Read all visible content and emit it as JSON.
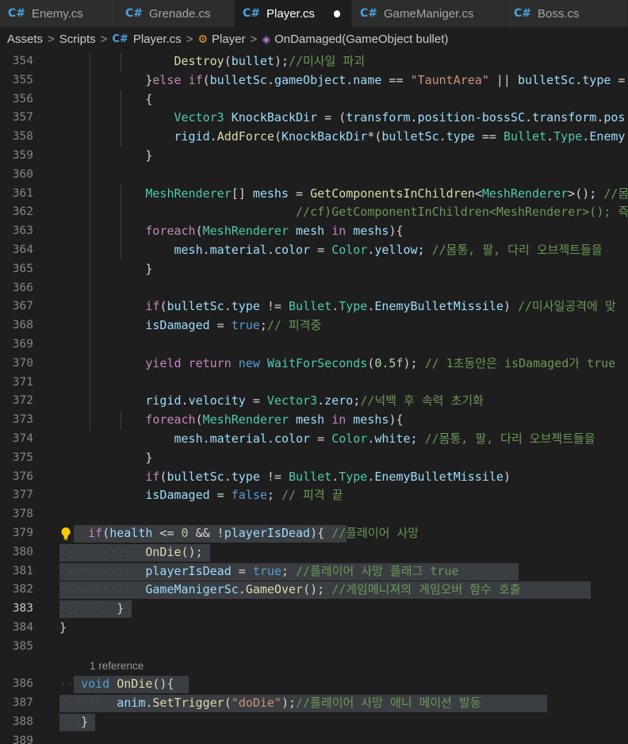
{
  "tabs": [
    {
      "icon": "C#",
      "label": "Enemy.cs",
      "active": false
    },
    {
      "icon": "C#",
      "label": "Grenade.cs",
      "active": false
    },
    {
      "icon": "C#",
      "label": "Player.cs",
      "active": true,
      "modified": true
    },
    {
      "icon": "C#",
      "label": "GameManiger.cs",
      "active": false
    },
    {
      "icon": "C#",
      "label": "Boss.cs",
      "active": false
    }
  ],
  "breadcrumb": {
    "assets": "Assets",
    "scripts": "Scripts",
    "file_icon": "C#",
    "file": "Player.cs",
    "class": "Player",
    "method": "OnDamaged(GameObject bullet)"
  },
  "codelens": "1 reference",
  "current_line": "383",
  "lines": [
    {
      "n": "354",
      "segs": [
        [
          "p",
          "        "
        ],
        [
          "f",
          "Destroy"
        ],
        [
          "p",
          "("
        ],
        [
          "v",
          "bullet"
        ],
        [
          "p",
          ");"
        ],
        [
          "c",
          "//미사일 파괴"
        ]
      ]
    },
    {
      "n": "355",
      "segs": [
        [
          "p",
          "    }"
        ],
        [
          "kc",
          "else"
        ],
        [
          "p",
          " "
        ],
        [
          "kc",
          "if"
        ],
        [
          "p",
          "("
        ],
        [
          "v",
          "bulletSc"
        ],
        [
          "p",
          "."
        ],
        [
          "v",
          "gameObject"
        ],
        [
          "p",
          "."
        ],
        [
          "v",
          "name"
        ],
        [
          "p",
          " == "
        ],
        [
          "s",
          "\"TauntArea\""
        ],
        [
          "p",
          " || "
        ],
        [
          "v",
          "bulletSc"
        ],
        [
          "p",
          "."
        ],
        [
          "v",
          "type"
        ],
        [
          "p",
          " ="
        ]
      ]
    },
    {
      "n": "356",
      "segs": [
        [
          "p",
          "    {"
        ]
      ]
    },
    {
      "n": "357",
      "segs": [
        [
          "p",
          "        "
        ],
        [
          "t",
          "Vector3"
        ],
        [
          "p",
          " "
        ],
        [
          "v",
          "KnockBackDir"
        ],
        [
          "p",
          " = ("
        ],
        [
          "v",
          "transform"
        ],
        [
          "p",
          "."
        ],
        [
          "v",
          "position"
        ],
        [
          "p",
          "-"
        ],
        [
          "v",
          "bossSC"
        ],
        [
          "p",
          "."
        ],
        [
          "v",
          "transform"
        ],
        [
          "p",
          "."
        ],
        [
          "v",
          "pos"
        ]
      ]
    },
    {
      "n": "358",
      "segs": [
        [
          "p",
          "        "
        ],
        [
          "v",
          "rigid"
        ],
        [
          "p",
          "."
        ],
        [
          "f",
          "AddForce"
        ],
        [
          "p",
          "("
        ],
        [
          "v",
          "KnockBackDir"
        ],
        [
          "p",
          "*("
        ],
        [
          "v",
          "bulletSc"
        ],
        [
          "p",
          "."
        ],
        [
          "v",
          "type"
        ],
        [
          "p",
          " == "
        ],
        [
          "t",
          "Bullet"
        ],
        [
          "p",
          "."
        ],
        [
          "t",
          "Type"
        ],
        [
          "p",
          "."
        ],
        [
          "v",
          "Enemy"
        ]
      ]
    },
    {
      "n": "359",
      "segs": [
        [
          "p",
          "    }"
        ]
      ]
    },
    {
      "n": "360",
      "segs": []
    },
    {
      "n": "361",
      "segs": [
        [
          "p",
          "    "
        ],
        [
          "t",
          "MeshRenderer"
        ],
        [
          "p",
          "[] "
        ],
        [
          "v",
          "meshs"
        ],
        [
          "p",
          " = "
        ],
        [
          "f",
          "GetComponentsInChildren"
        ],
        [
          "p",
          "<"
        ],
        [
          "t",
          "MeshRenderer"
        ],
        [
          "p",
          ">(); "
        ],
        [
          "c",
          "//몸"
        ]
      ]
    },
    {
      "n": "362",
      "segs": [
        [
          "p",
          "                         "
        ],
        [
          "c",
          "//cf)GetComponentInChildren<MeshRenderer>(); 즉"
        ]
      ]
    },
    {
      "n": "363",
      "segs": [
        [
          "p",
          "    "
        ],
        [
          "kc",
          "foreach"
        ],
        [
          "p",
          "("
        ],
        [
          "t",
          "MeshRenderer"
        ],
        [
          "p",
          " "
        ],
        [
          "v",
          "mesh"
        ],
        [
          "p",
          " "
        ],
        [
          "kc",
          "in"
        ],
        [
          "p",
          " "
        ],
        [
          "v",
          "meshs"
        ],
        [
          "p",
          "){"
        ]
      ]
    },
    {
      "n": "364",
      "segs": [
        [
          "p",
          "        "
        ],
        [
          "v",
          "mesh"
        ],
        [
          "p",
          "."
        ],
        [
          "v",
          "material"
        ],
        [
          "p",
          "."
        ],
        [
          "v",
          "color"
        ],
        [
          "p",
          " = "
        ],
        [
          "t",
          "Color"
        ],
        [
          "p",
          "."
        ],
        [
          "v",
          "yellow"
        ],
        [
          "p",
          "; "
        ],
        [
          "c",
          "//몸통, 팔, 다리 오브젝트들을"
        ]
      ]
    },
    {
      "n": "365",
      "segs": [
        [
          "p",
          "    }"
        ]
      ]
    },
    {
      "n": "366",
      "segs": []
    },
    {
      "n": "367",
      "segs": [
        [
          "p",
          "    "
        ],
        [
          "kc",
          "if"
        ],
        [
          "p",
          "("
        ],
        [
          "v",
          "bulletSc"
        ],
        [
          "p",
          "."
        ],
        [
          "v",
          "type"
        ],
        [
          "p",
          " != "
        ],
        [
          "t",
          "Bullet"
        ],
        [
          "p",
          "."
        ],
        [
          "t",
          "Type"
        ],
        [
          "p",
          "."
        ],
        [
          "v",
          "EnemyBulletMissile"
        ],
        [
          "p",
          ") "
        ],
        [
          "c",
          "//미사일공격에 맞"
        ]
      ]
    },
    {
      "n": "368",
      "segs": [
        [
          "p",
          "    "
        ],
        [
          "v",
          "isDamaged"
        ],
        [
          "p",
          " = "
        ],
        [
          "k",
          "true"
        ],
        [
          "p",
          ";"
        ],
        [
          "c",
          "// 피격중"
        ]
      ]
    },
    {
      "n": "369",
      "segs": []
    },
    {
      "n": "370",
      "segs": [
        [
          "p",
          "    "
        ],
        [
          "kc",
          "yield"
        ],
        [
          "p",
          " "
        ],
        [
          "kc",
          "return"
        ],
        [
          "p",
          " "
        ],
        [
          "k",
          "new"
        ],
        [
          "p",
          " "
        ],
        [
          "t",
          "WaitForSeconds"
        ],
        [
          "p",
          "("
        ],
        [
          "n",
          "0.5f"
        ],
        [
          "p",
          "); "
        ],
        [
          "c",
          "// 1초동안은 isDamaged가 true"
        ]
      ]
    },
    {
      "n": "371",
      "segs": []
    },
    {
      "n": "372",
      "segs": [
        [
          "p",
          "    "
        ],
        [
          "v",
          "rigid"
        ],
        [
          "p",
          "."
        ],
        [
          "v",
          "velocity"
        ],
        [
          "p",
          " = "
        ],
        [
          "t",
          "Vector3"
        ],
        [
          "p",
          "."
        ],
        [
          "v",
          "zero"
        ],
        [
          "p",
          ";"
        ],
        [
          "c",
          "//넉백 후 속력 초기화"
        ]
      ]
    },
    {
      "n": "373",
      "segs": [
        [
          "p",
          "    "
        ],
        [
          "kc",
          "foreach"
        ],
        [
          "p",
          "("
        ],
        [
          "t",
          "MeshRenderer"
        ],
        [
          "p",
          " "
        ],
        [
          "v",
          "mesh"
        ],
        [
          "p",
          " "
        ],
        [
          "kc",
          "in"
        ],
        [
          "p",
          " "
        ],
        [
          "v",
          "meshs"
        ],
        [
          "p",
          "){"
        ]
      ]
    },
    {
      "n": "374",
      "segs": [
        [
          "p",
          "        "
        ],
        [
          "v",
          "mesh"
        ],
        [
          "p",
          "."
        ],
        [
          "v",
          "material"
        ],
        [
          "p",
          "."
        ],
        [
          "v",
          "color"
        ],
        [
          "p",
          " = "
        ],
        [
          "t",
          "Color"
        ],
        [
          "p",
          "."
        ],
        [
          "v",
          "white"
        ],
        [
          "p",
          "; "
        ],
        [
          "c",
          "//몸통, 팔, 다리 오브젝트들을"
        ]
      ]
    },
    {
      "n": "375",
      "segs": [
        [
          "p",
          "    }"
        ]
      ]
    },
    {
      "n": "376",
      "segs": [
        [
          "p",
          "    "
        ],
        [
          "kc",
          "if"
        ],
        [
          "p",
          "("
        ],
        [
          "v",
          "bulletSc"
        ],
        [
          "p",
          "."
        ],
        [
          "v",
          "type"
        ],
        [
          "p",
          " != "
        ],
        [
          "t",
          "Bullet"
        ],
        [
          "p",
          "."
        ],
        [
          "t",
          "Type"
        ],
        [
          "p",
          "."
        ],
        [
          "v",
          "EnemyBulletMissile"
        ],
        [
          "p",
          ")"
        ]
      ]
    },
    {
      "n": "377",
      "segs": [
        [
          "p",
          "    "
        ],
        [
          "v",
          "isDamaged"
        ],
        [
          "p",
          " = "
        ],
        [
          "k",
          "false"
        ],
        [
          "p",
          "; "
        ],
        [
          "c",
          "// 피격 끝"
        ]
      ]
    },
    {
      "n": "378",
      "segs": []
    },
    {
      "n": "379",
      "segs": [
        [
          "ws",
          "··"
        ],
        [
          "p",
          "  "
        ],
        [
          "kc",
          "if"
        ],
        [
          "p",
          "("
        ],
        [
          "v",
          "health"
        ],
        [
          "p",
          " <= "
        ],
        [
          "n",
          "0"
        ],
        [
          "p",
          " && !"
        ],
        [
          "v",
          "playerIsDead"
        ],
        [
          "p",
          "){ "
        ],
        [
          "c",
          "//플레이어 사망"
        ]
      ]
    },
    {
      "n": "380",
      "segs": [
        [
          "ws",
          "··········"
        ],
        [
          "p",
          "  "
        ],
        [
          "f",
          "OnDie"
        ],
        [
          "p",
          "();"
        ]
      ]
    },
    {
      "n": "381",
      "segs": [
        [
          "ws",
          "··········"
        ],
        [
          "p",
          "  "
        ],
        [
          "v",
          "playerIsDead"
        ],
        [
          "p",
          " = "
        ],
        [
          "k",
          "true"
        ],
        [
          "p",
          "; "
        ],
        [
          "c",
          "//플레이어 사망 플래그 true"
        ]
      ]
    },
    {
      "n": "382",
      "segs": [
        [
          "ws",
          "··········"
        ],
        [
          "p",
          "  "
        ],
        [
          "v",
          "GameManigerSc"
        ],
        [
          "p",
          "."
        ],
        [
          "f",
          "GameOver"
        ],
        [
          "p",
          "(); "
        ],
        [
          "c",
          "//게임메니져의 게임오버 함수 호출"
        ]
      ]
    },
    {
      "n": "383",
      "segs": [
        [
          "ws",
          "······"
        ],
        [
          "p",
          "  }"
        ]
      ]
    },
    {
      "n": "384",
      "segs": [
        [
          "p",
          "}"
        ]
      ]
    },
    {
      "n": "385",
      "segs": []
    },
    {
      "n": "386",
      "segs": [
        [
          "ws",
          "··"
        ],
        [
          "p",
          " "
        ],
        [
          "k",
          "void"
        ],
        [
          "p",
          " "
        ],
        [
          "f",
          "OnDie"
        ],
        [
          "p",
          "(){"
        ]
      ]
    },
    {
      "n": "387",
      "segs": [
        [
          "ws",
          "······"
        ],
        [
          "p",
          "  "
        ],
        [
          "v",
          "anim"
        ],
        [
          "p",
          "."
        ],
        [
          "f",
          "SetTrigger"
        ],
        [
          "p",
          "("
        ],
        [
          "s",
          "\"doDie\""
        ],
        [
          "p",
          ");"
        ],
        [
          "c",
          "//플레이어 사망 애니 메이션 발동"
        ]
      ]
    },
    {
      "n": "388",
      "segs": [
        [
          "ws",
          "···"
        ],
        [
          "p",
          "}"
        ]
      ]
    },
    {
      "n": "389",
      "segs": []
    }
  ],
  "selection_bg": "#3a3d41"
}
